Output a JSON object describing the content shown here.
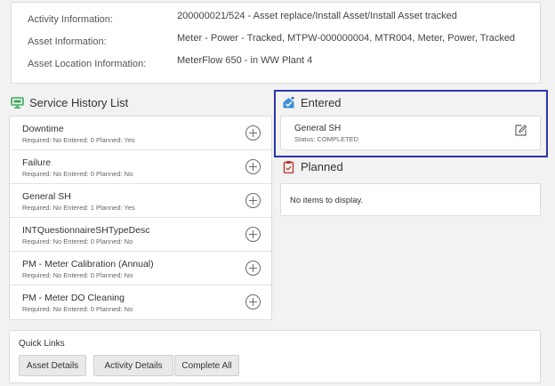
{
  "activity": {
    "rows": [
      {
        "label": "Activity Information:",
        "value": "200000021/524 - Asset replace/Install Asset/Install Asset tracked"
      },
      {
        "label": "Asset Information:",
        "value": "Meter - Power - Tracked, MTPW-000000004, MTR004, Meter, Power, Tracked"
      },
      {
        "label": "Asset Location Information:",
        "value": "MeterFlow 650 - in WW Plant 4"
      }
    ]
  },
  "service_history": {
    "title": "Service History List",
    "icon": "monitor-icon",
    "items": [
      {
        "name": "Downtime",
        "meta": "Required: No   Entered: 0   Planned: Yes"
      },
      {
        "name": "Failure",
        "meta": "Required: No   Entered: 0   Planned: No"
      },
      {
        "name": "General SH",
        "meta": "Required: No   Entered: 1   Planned: Yes"
      },
      {
        "name": "INTQuestionnaireSHTypeDesc",
        "meta": "Required: No   Entered: 0   Planned: No"
      },
      {
        "name": "PM - Meter Calibration (Annual)",
        "meta": "Required: No   Entered: 0   Planned: No"
      },
      {
        "name": "PM - Meter DO Cleaning",
        "meta": "Required: No   Entered: 0   Planned: No"
      }
    ]
  },
  "entered": {
    "title": "Entered",
    "icon": "house-check-icon",
    "items": [
      {
        "name": "General SH",
        "status": "Status: COMPLETED"
      }
    ]
  },
  "planned": {
    "title": "Planned",
    "icon": "clipboard-icon",
    "empty_text": "No items to display."
  },
  "quick_links": {
    "title": "Quick Links",
    "buttons": [
      "Asset Details",
      "Activity Details",
      "Complete All"
    ]
  },
  "colors": {
    "highlight_border": "#2934b0",
    "service_icon": "#3aaa5a",
    "entered_icon": "#3b8fd6",
    "planned_icon": "#c0392b"
  }
}
